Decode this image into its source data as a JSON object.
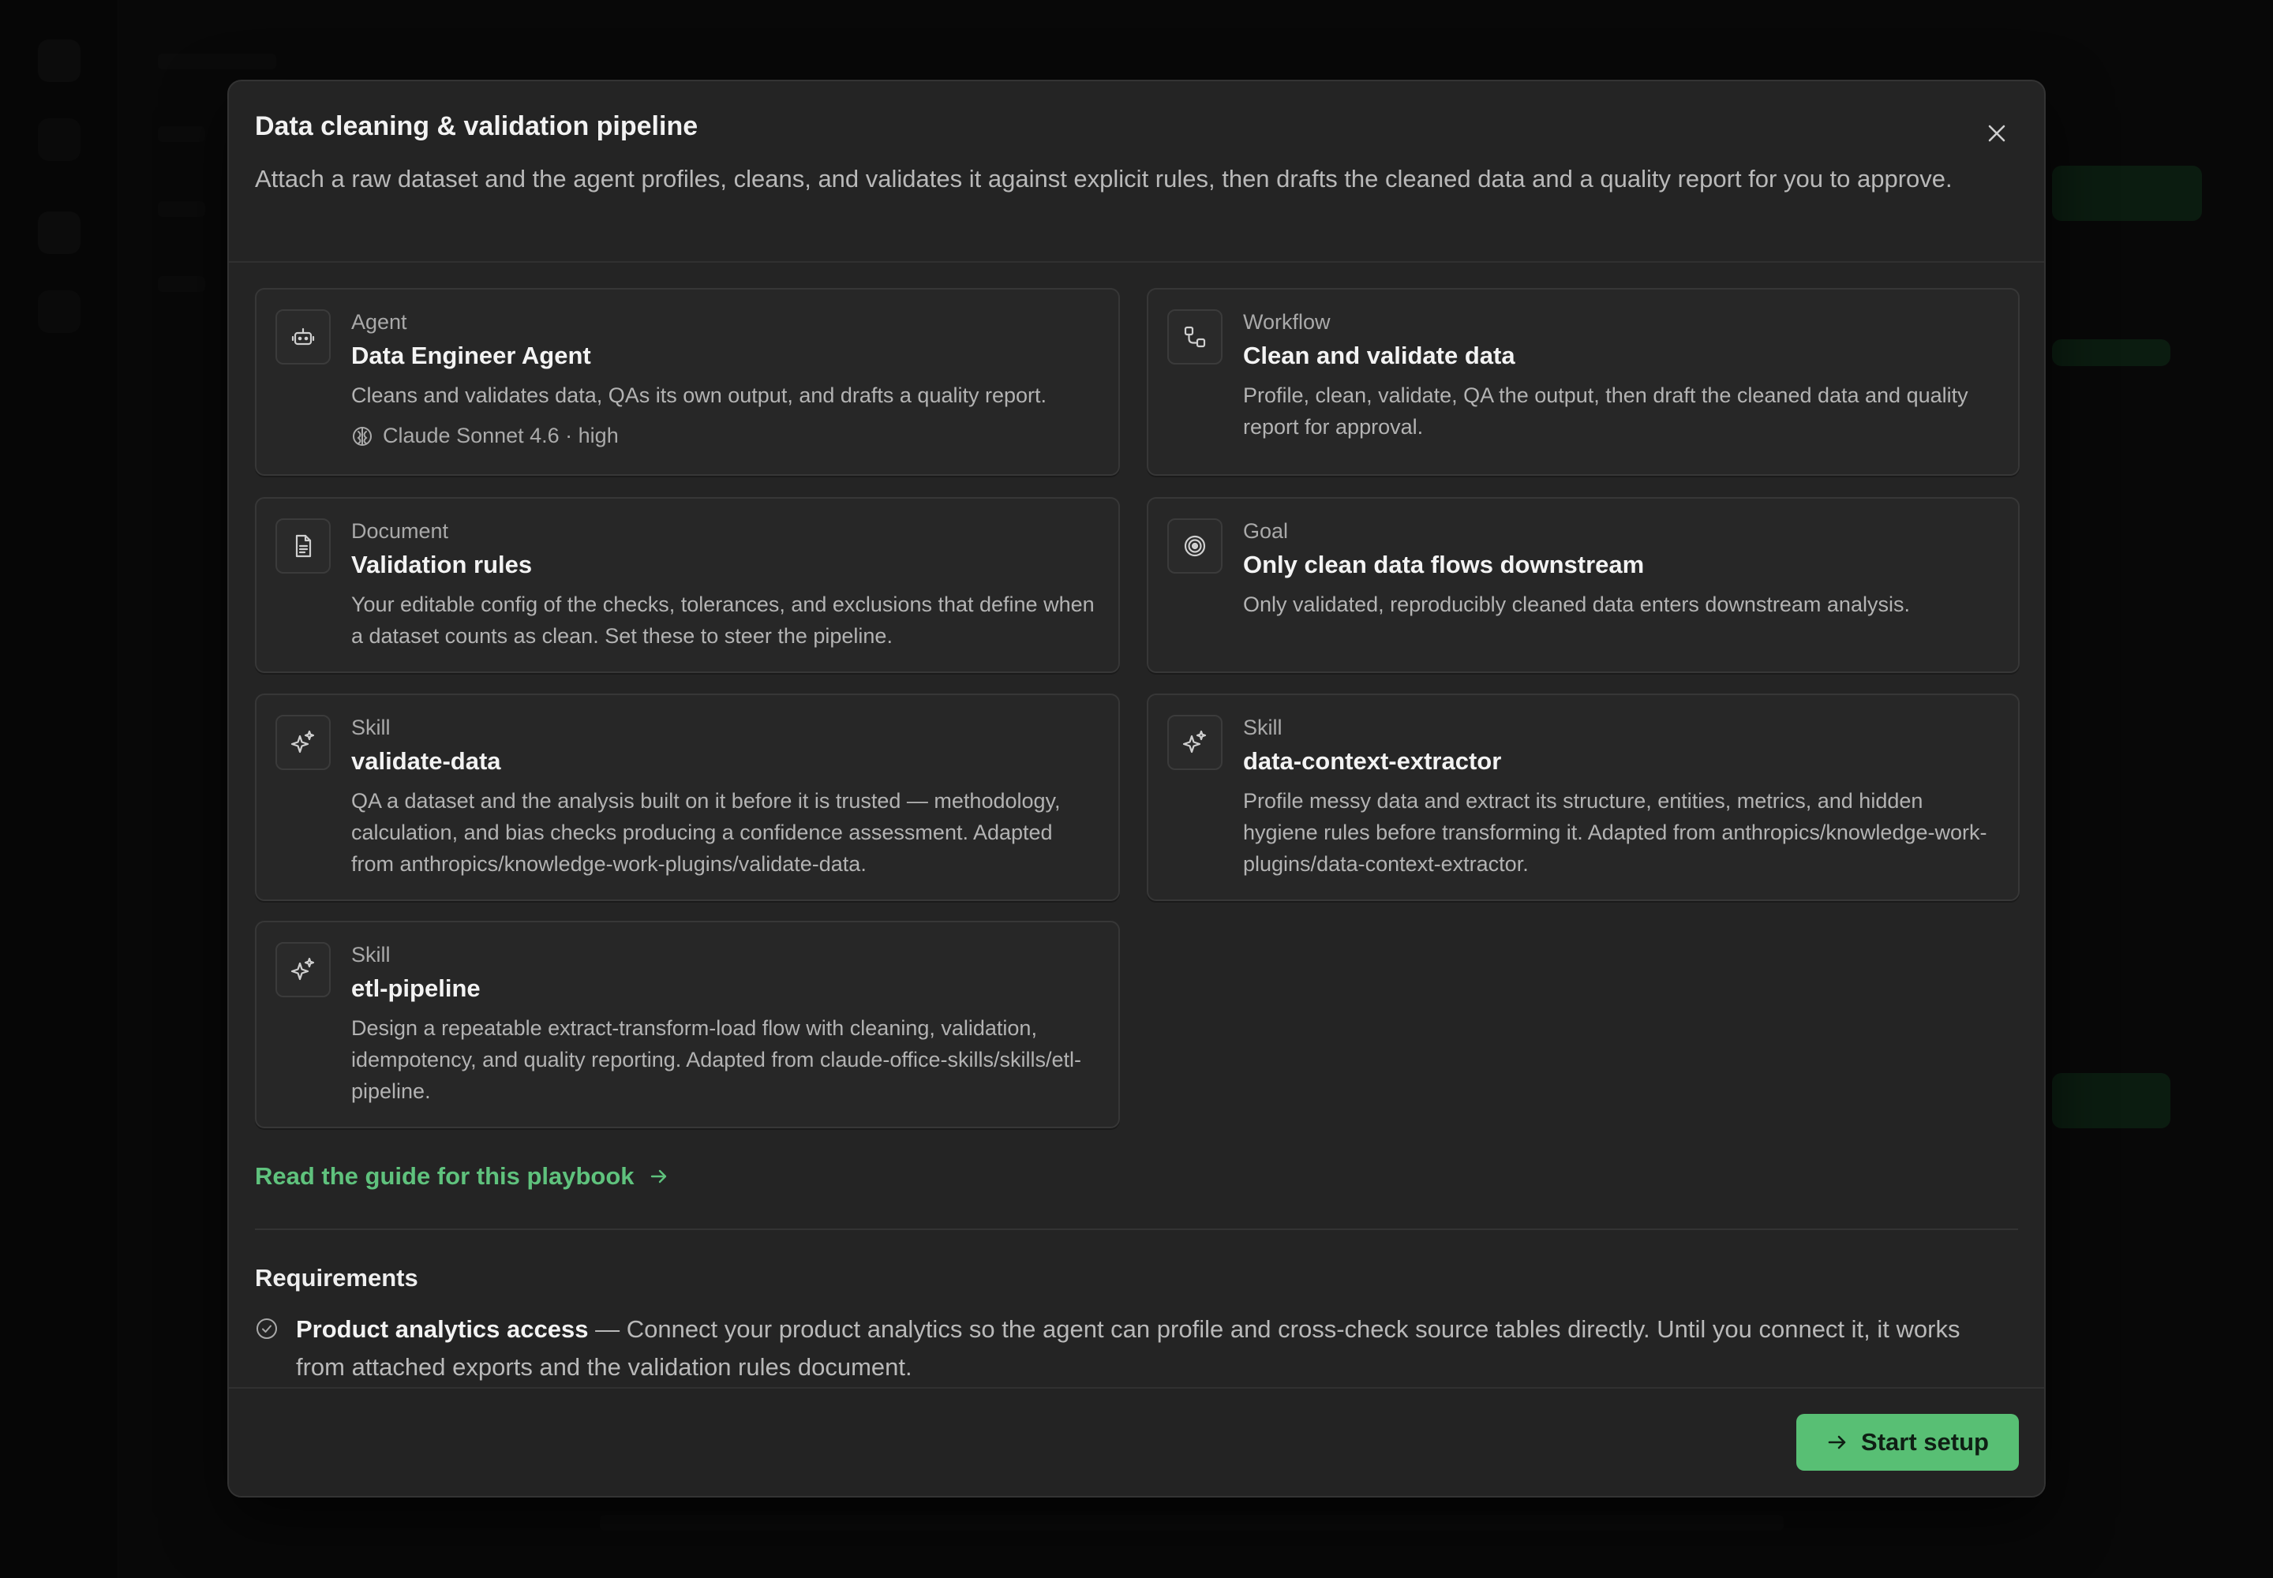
{
  "modal": {
    "title": "Data cleaning & validation pipeline",
    "description": "Attach a raw dataset and the agent profiles, cleans, and validates it against explicit rules, then drafts the cleaned data and a quality report for you to approve.",
    "close_icon": "close-icon"
  },
  "cards": [
    {
      "kind": "Agent",
      "title": "Data Engineer Agent",
      "description": "Cleans and validates data, QAs its own output, and drafts a quality report.",
      "meta": "Claude Sonnet 4.6 · high",
      "icon": "robot-icon"
    },
    {
      "kind": "Workflow",
      "title": "Clean and validate data",
      "description": "Profile, clean, validate, QA the output, then draft the cleaned data and quality report for approval.",
      "icon": "workflow-icon"
    },
    {
      "kind": "Document",
      "title": "Validation rules",
      "description": "Your editable config of the checks, tolerances, and exclusions that define when a dataset counts as clean. Set these to steer the pipeline.",
      "icon": "document-icon"
    },
    {
      "kind": "Goal",
      "title": "Only clean data flows downstream",
      "description": "Only validated, reproducibly cleaned data enters downstream analysis.",
      "icon": "target-icon"
    },
    {
      "kind": "Skill",
      "title": "validate-data",
      "description": "QA a dataset and the analysis built on it before it is trusted — methodology, calculation, and bias checks producing a confidence assessment. Adapted from anthropics/knowledge-work-plugins/validate-data.",
      "icon": "sparkle-icon"
    },
    {
      "kind": "Skill",
      "title": "data-context-extractor",
      "description": "Profile messy data and extract its structure, entities, metrics, and hidden hygiene rules before transforming it. Adapted from anthropics/knowledge-work-plugins/data-context-extractor.",
      "icon": "sparkle-icon"
    },
    {
      "kind": "Skill",
      "title": "etl-pipeline",
      "description": "Design a repeatable extract-transform-load flow with cleaning, validation, idempotency, and quality reporting. Adapted from claude-office-skills/skills/etl-pipeline.",
      "icon": "sparkle-icon"
    }
  ],
  "guide_link": "Read the guide for this playbook",
  "requirements": {
    "title": "Requirements",
    "items": [
      {
        "name": "Product analytics access",
        "text": " — Connect your product analytics so the agent can profile and cross-check source tables directly. Until you connect it, it works from attached exports and the validation rules document."
      }
    ]
  },
  "footer": {
    "start_label": "Start setup"
  },
  "colors": {
    "accent": "#58bf74",
    "link": "#5fc27d",
    "modal_bg": "#242424"
  }
}
